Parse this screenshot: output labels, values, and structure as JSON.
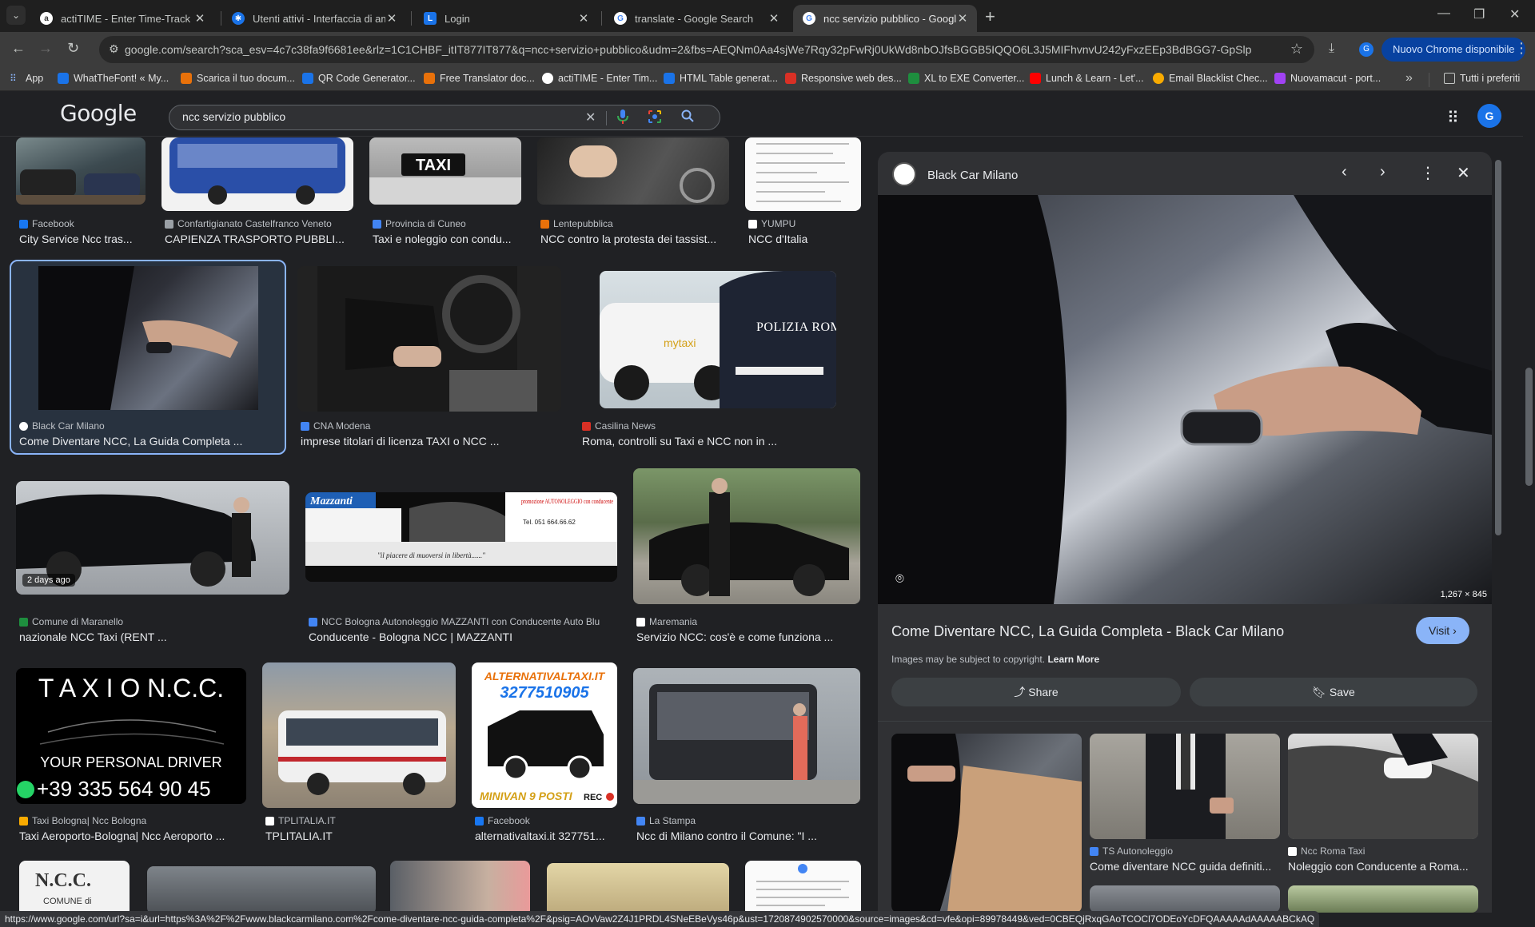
{
  "browser": {
    "tabs": [
      {
        "title": "actiTIME - Enter Time-Track",
        "fav_color": "#ffffff",
        "fav_text": "a"
      },
      {
        "title": "Utenti attivi - Interfaccia di amm",
        "fav_color": "#1a73e8",
        "fav_text": "✱"
      },
      {
        "title": "Login",
        "fav_color": "#1a73e8",
        "fav_text": "L"
      },
      {
        "title": "translate - Google Search",
        "fav_color": "#ffffff",
        "fav_text": "G"
      },
      {
        "title": "ncc servizio pubblico - Google S",
        "fav_color": "#ffffff",
        "fav_text": "G"
      }
    ],
    "url": "google.com/search?sca_esv=4c7c38fa9f6681ee&rlz=1C1CHBF_itIT877IT877&q=ncc+servizio+pubblico&udm=2&fbs=AEQNm0Aa4sjWe7Rqy32pFwRj0UkWd8nbOJfsBGGB5IQQO6L3J5MIFhvnvU242yFxzEEp3BdBGG7-GpSlpGrWJfg4SJp...",
    "update_label": "Nuovo Chrome disponibile",
    "bookmarks": [
      {
        "label": "App",
        "color": "#8ab4f8"
      },
      {
        "label": "WhatTheFont! « My...",
        "color": "#1a73e8"
      },
      {
        "label": "Scarica il tuo docum...",
        "color": "#e8710a"
      },
      {
        "label": "QR Code Generator...",
        "color": "#1a73e8"
      },
      {
        "label": "Free Translator doc...",
        "color": "#e8710a"
      },
      {
        "label": "actiTIME - Enter Tim...",
        "color": "#ffffff"
      },
      {
        "label": "HTML Table generat...",
        "color": "#1a73e8"
      },
      {
        "label": "Responsive web des...",
        "color": "#d93025"
      },
      {
        "label": "XL to EXE Converter...",
        "color": "#1e8e3e"
      },
      {
        "label": "Lunch & Learn - Let'...",
        "color": "#ff0000"
      },
      {
        "label": "Email Blacklist Chec...",
        "color": "#f9ab00"
      },
      {
        "label": "Nuovamacut - port...",
        "color": "#a142f4"
      }
    ],
    "all_bookmarks": "Tutti i preferiti",
    "status_url": "https://www.google.com/url?sa=i&url=https%3A%2F%2Fwww.blackcarmilano.com%2Fcome-diventare-ncc-guida-completa%2F&psig=AOvVaw2Z4J1PRDL4SNeEBeVys46p&ust=1720874902570000&source=images&cd=vfe&opi=89978449&ved=0CBEQjRxqGAoTCOCl7ODEoYcDFQAAAAAdAAAAABCkAQ"
  },
  "google": {
    "logo": "Google",
    "query": "ncc servizio pubblico",
    "avatar": "G"
  },
  "results": {
    "row1": [
      {
        "source": "Facebook",
        "caption": "City Service Ncc tras...",
        "color": "#1877f2"
      },
      {
        "source": "Confartigianato Castelfranco Veneto",
        "caption": "CAPIENZA TRASPORTO PUBBLI...",
        "color": "#9aa0a6"
      },
      {
        "source": "Provincia di Cuneo",
        "caption": "Taxi e noleggio con condu...",
        "color": "#4285f4"
      },
      {
        "source": "Lentepubblica",
        "caption": "NCC contro la protesta dei tassist...",
        "color": "#e8710a"
      },
      {
        "source": "YUMPU",
        "caption": "NCC d'Italia",
        "color": "#ffffff"
      }
    ],
    "row2": [
      {
        "source": "Black Car Milano",
        "caption": "Come Diventare NCC, La Guida Completa ...",
        "color": "#ffffff"
      },
      {
        "source": "CNA Modena",
        "caption": "imprese titolari di licenza TAXI o NCC ...",
        "color": "#4285f4"
      },
      {
        "source": "Casilina News",
        "caption": "Roma, controlli su Taxi e NCC non in ...",
        "color": "#d93025"
      }
    ],
    "row2_images": {
      "police_text": "POLIZIA ROMA CAPITALE",
      "taxi_brand": "mytaxi"
    },
    "row3": [
      {
        "source": "Comune di Maranello",
        "caption": "nazionale NCC Taxi (RENT ...",
        "color": "#1e8e3e",
        "badge": "2 days ago"
      },
      {
        "source": "NCC Bologna Autonoleggio MAZZANTI con Conducente Auto Blu",
        "caption": "Conducente - Bologna NCC | MAZZANTI",
        "color": "#4285f4"
      },
      {
        "source": "Maremania",
        "caption": "Servizio NCC: cos'è e come funziona ...",
        "color": "#ffffff"
      }
    ],
    "mazzanti": {
      "brand": "Mazzanti",
      "promo": "promozione AUTONOLEGGIO con conducente",
      "tel": "Tel. 051 664.66.62",
      "slogan": "\"il piacere di muoversi in libertà......\""
    },
    "row4": [
      {
        "source": "Taxi Bologna| Ncc Bologna",
        "caption": "Taxi Aeroporto-Bologna| Ncc Aeroporto ...",
        "color": "#f9ab00"
      },
      {
        "source": "TPLITALIA.IT",
        "caption": "TPLITALIA.IT",
        "color": "#ffffff"
      },
      {
        "source": "Facebook",
        "caption": "alternativaltaxi.it 327751...",
        "color": "#1877f2"
      },
      {
        "source": "La Stampa",
        "caption": "Ncc di Milano contro il Comune: \"I ...",
        "color": "#4285f4"
      }
    ],
    "taxi_ad": {
      "title": "T A X I O N.C.C.",
      "line": "YOUR PERSONAL DRIVER",
      "phone": "+39 335 564 90 45"
    },
    "alt_ad": {
      "brand": "ALTERNATIVALTAXI.IT",
      "phone": "3277510905",
      "footer": "MINIVAN 9 POSTI",
      "rec": "REC"
    },
    "ncc_sign": {
      "title": "N.C.C.",
      "sub": "COMUNE di"
    }
  },
  "panel": {
    "site": "Black Car Milano",
    "dims": "1,267 × 845",
    "title": "Come Diventare NCC, La Guida Completa - Black Car Milano",
    "visit": "Visit",
    "copyright": "Images may be subject to copyright.",
    "learn_more": "Learn More",
    "share": "Share",
    "save": "Save",
    "related": [
      {
        "source": "TS Autonoleggio",
        "caption": "Come diventare NCC guida definiti...",
        "color": "#4285f4"
      },
      {
        "source": "Ncc Roma Taxi",
        "caption": "Noleggio con Conducente a Roma...",
        "color": "#ffffff"
      }
    ]
  }
}
